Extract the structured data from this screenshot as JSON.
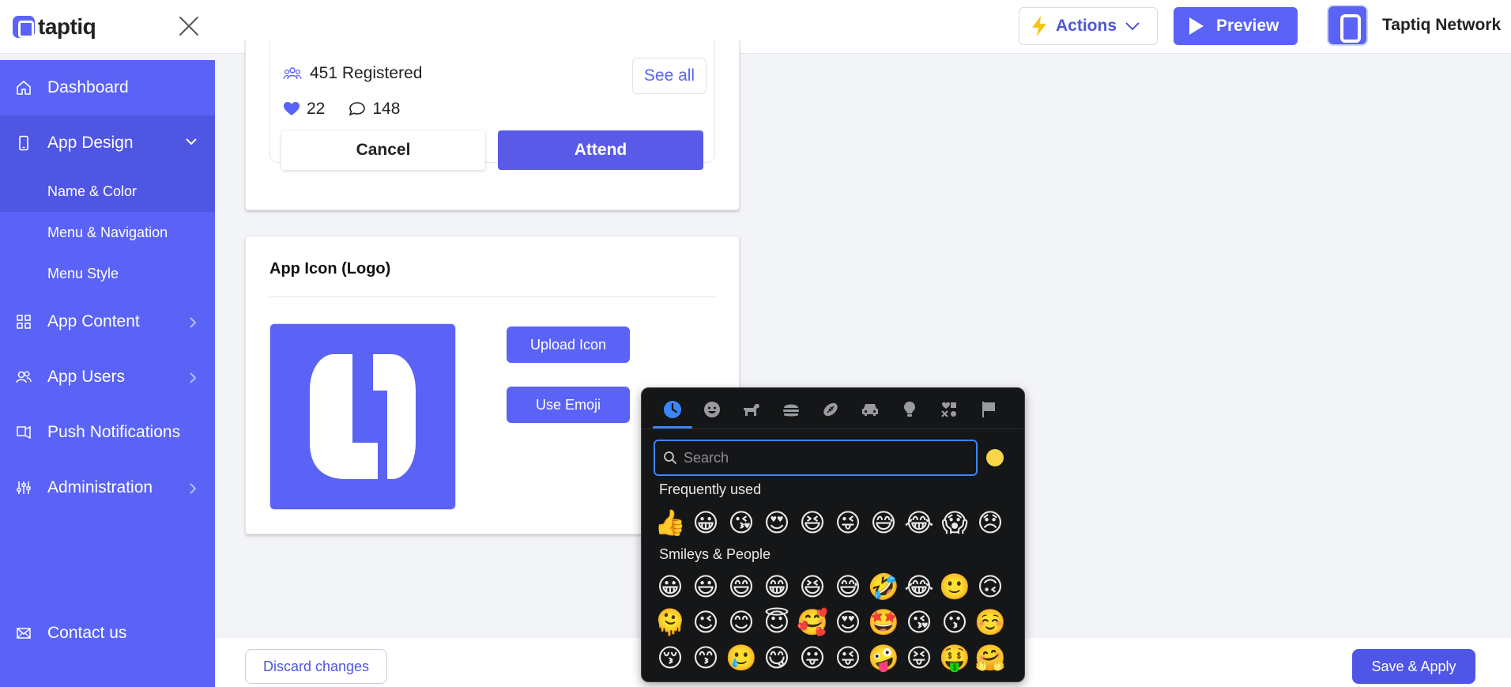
{
  "header": {
    "logo_text": "taptiq",
    "actions_label": "Actions",
    "preview_label": "Preview",
    "account_name": "Taptiq Network"
  },
  "sidebar": {
    "items": [
      {
        "label": "Dashboard",
        "icon": "home-icon"
      },
      {
        "label": "App Design",
        "icon": "phone-icon"
      },
      {
        "label": "App Content",
        "icon": "grid-icon"
      },
      {
        "label": "App Users",
        "icon": "users-icon"
      },
      {
        "label": "Push Notifications",
        "icon": "send-icon"
      },
      {
        "label": "Administration",
        "icon": "sliders-icon"
      }
    ],
    "sub_items": [
      "Name & Color",
      "Menu & Navigation",
      "Menu Style"
    ],
    "contact_label": "Contact us"
  },
  "event_card": {
    "registered": "451 Registered",
    "see_all": "See all",
    "likes": "22",
    "comments": "148",
    "cancel_label": "Cancel",
    "attend_label": "Attend"
  },
  "app_icon": {
    "title": "App Icon (Logo)",
    "upload_label": "Upload Icon",
    "emoji_label": "Use Emoji"
  },
  "bottom": {
    "discard_label": "Discard changes",
    "save_label": "Save & Apply"
  },
  "emoji_picker": {
    "search_placeholder": "Search",
    "categories": [
      "recent",
      "smileys",
      "animals",
      "food",
      "activity",
      "travel",
      "objects",
      "symbols",
      "flags"
    ],
    "frequently_used_label": "Frequently used",
    "frequently_used": [
      "👍",
      "😀",
      "😘",
      "😍",
      "😆",
      "😜",
      "😅",
      "😂",
      "😱",
      "😞"
    ],
    "smileys_label": "Smileys & People",
    "smileys": [
      [
        "😀",
        "😃",
        "😄",
        "😁",
        "😆",
        "😅",
        "🤣",
        "😂",
        "🙂",
        "🙃"
      ],
      [
        "🫠",
        "😉",
        "😊",
        "😇",
        "🥰",
        "😍",
        "🤩",
        "😘",
        "😗",
        "☺️"
      ],
      [
        "😚",
        "😙",
        "🥲",
        "😋",
        "😛",
        "😜",
        "🤪",
        "😝",
        "🤑",
        "🤗"
      ]
    ]
  },
  "colors": {
    "brand": "#5a63f5",
    "sidebar_active": "#4f56e2",
    "picker_bg": "#151617",
    "picker_accent": "#3a86ff"
  }
}
